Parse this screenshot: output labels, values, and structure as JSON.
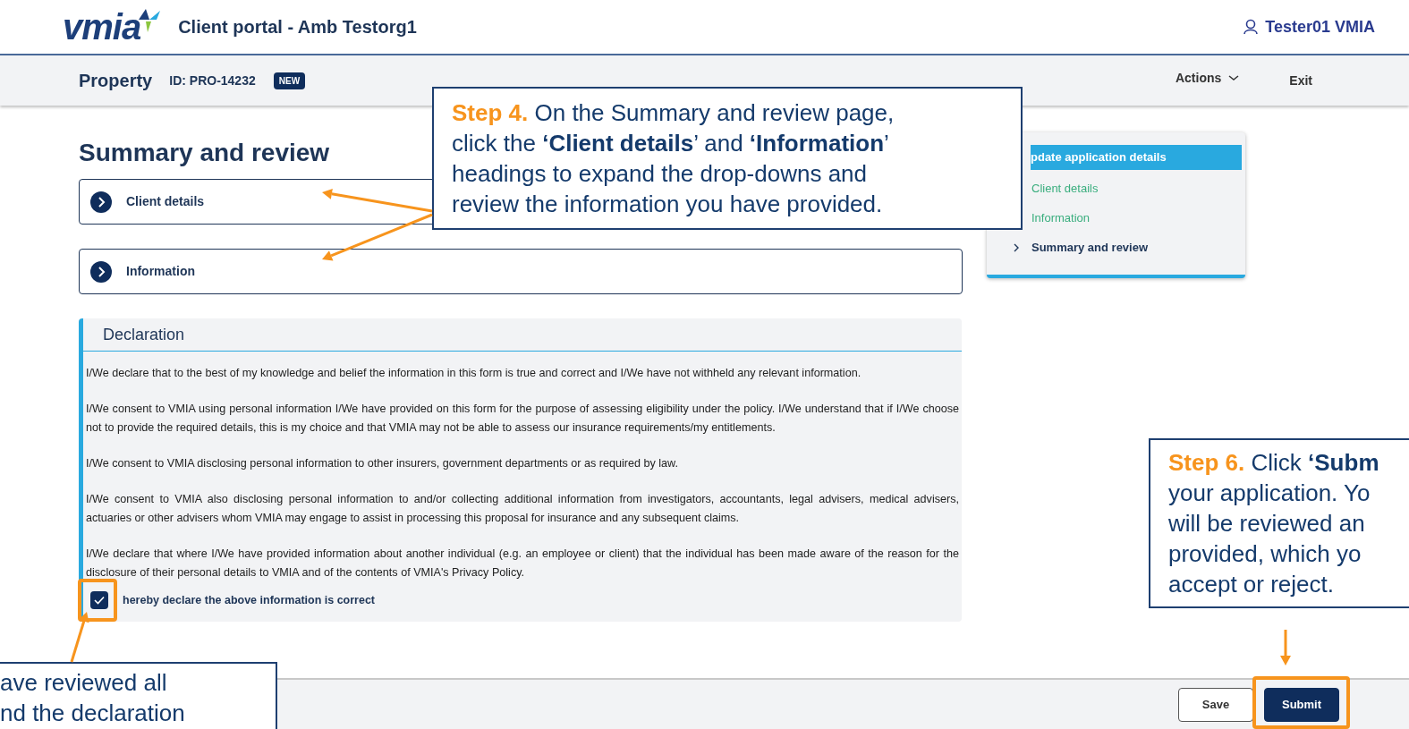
{
  "header": {
    "logo": "vmia",
    "title": "Client portal - Amb Testorg1",
    "user": "Tester01 VMIA"
  },
  "subheader": {
    "product": "Property",
    "id": "ID: PRO-14232",
    "badge": "NEW",
    "actions": "Actions",
    "exit": "Exit"
  },
  "page_title": "Summary and review",
  "sections": [
    {
      "label": "Client details",
      "expanded": false
    },
    {
      "label": "Information",
      "expanded": false
    }
  ],
  "declaration": {
    "title": "Declaration",
    "paragraphs": [
      "I/We declare that to the best of my knowledge and belief the information in this form is true and correct and I/We have not withheld any relevant information.",
      "I/We consent to VMIA using personal information I/We have provided on this form for the purpose of assessing eligibility under the policy. I/We understand that if I/We choose not to provide the required details, this is my choice and that VMIA may not be able to assess our insurance requirements/my entitlements.",
      "I/We consent to VMIA disclosing personal information to other insurers, government departments or as required by law.",
      "I/We consent to VMIA also disclosing personal information to and/or collecting additional information from investigators, accountants, legal advisers, medical advisers, actuaries or other advisers whom VMIA may engage to assist in processing this proposal for insurance and any subsequent claims.",
      "I/We declare that where I/We have provided information about another individual (e.g. an employee or client) that the individual has been made aware of the reason for the disclosure of their personal details to VMIA and of the contents of VMIA's Privacy Policy."
    ],
    "checkbox": {
      "label": "hereby declare the above information is correct",
      "checked": true
    }
  },
  "side_nav": {
    "heading": "pdate application details",
    "items": [
      {
        "label": "Client details",
        "selected": false
      },
      {
        "label": "Information",
        "selected": false
      },
      {
        "label": "Summary and review",
        "selected": true
      }
    ]
  },
  "footer": {
    "buttons": [
      {
        "label": "Save",
        "kind": "secondary"
      },
      {
        "label": "Submit",
        "kind": "primary"
      }
    ]
  },
  "callouts": [
    {
      "step": "Step 4.",
      "lines": [
        "On the Summary and review page,",
        "click the **‘Client details**’ and **‘Information**’",
        "headings to expand the drop-downs and",
        "review the information you have provided."
      ]
    },
    {
      "step": "Step 6.",
      "lines": [
        "Click **‘Subm**",
        "your application. Yo",
        "will be reviewed an",
        "provided, which yo",
        "accept or reject."
      ]
    },
    {
      "lines": [
        "ave reviewed all",
        "nd the declaration"
      ]
    }
  ]
}
